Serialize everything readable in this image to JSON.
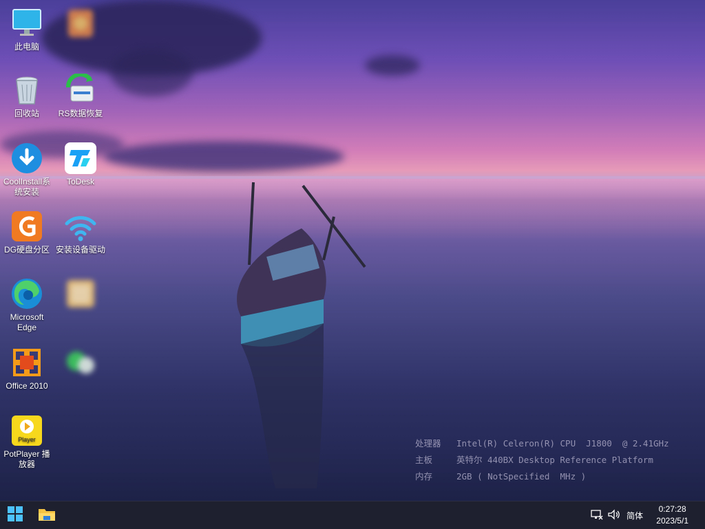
{
  "desktop": {
    "icons": [
      {
        "label": "此电脑",
        "icon": "monitor-icon"
      },
      {
        "label": "",
        "icon": "blurred-app-icon"
      },
      {
        "label": "回收站",
        "icon": "recycle-bin-icon"
      },
      {
        "label": "RS数据恢复",
        "icon": "data-recovery-icon"
      },
      {
        "label": "CoolInstall系统安装",
        "icon": "download-icon"
      },
      {
        "label": "ToDesk",
        "icon": "todesk-icon"
      },
      {
        "label": "DG硬盘分区",
        "icon": "diskgenius-icon"
      },
      {
        "label": "安装设备驱动",
        "icon": "wifi-icon"
      },
      {
        "label": "Microsoft Edge",
        "icon": "edge-icon"
      },
      {
        "label": "",
        "icon": "blurred-app-icon"
      },
      {
        "label": "Office 2010",
        "icon": "office-icon"
      },
      {
        "label": "",
        "icon": "blurred-app-icon"
      },
      {
        "label": "PotPlayer 播放器",
        "icon": "potplayer-icon"
      }
    ]
  },
  "sysinfo": {
    "cpu_key": "处理器",
    "cpu_val": "Intel(R) Celeron(R) CPU  J1800  @ 2.41GHz",
    "board_key": "主板",
    "board_val": "英特尔 440BX Desktop Reference Platform",
    "mem_key": "内存",
    "mem_val": "2GB ( NotSpecified  MHz )"
  },
  "taskbar": {
    "start_icon": "windows-start-icon",
    "explorer_icon": "file-explorer-icon",
    "ime_label": "简体",
    "time": "0:27:28",
    "date": "2023/5/1"
  },
  "colors": {
    "taskbar_bg": "#1e2030",
    "sky_top": "#4a3f9a",
    "horizon_pink": "#e69ab8"
  }
}
